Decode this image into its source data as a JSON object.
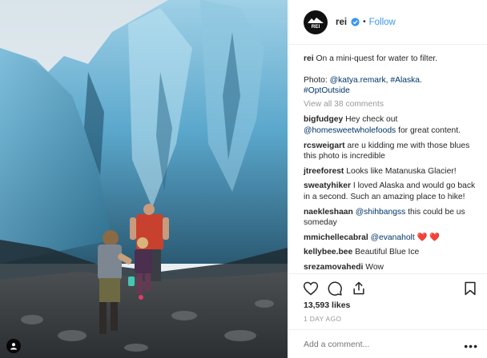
{
  "post": {
    "author": "rei",
    "follow_label": "Follow",
    "dot": "•",
    "caption": {
      "user": "rei",
      "text": "On a mini-quest for water to filter.",
      "photo_prefix": "Photo: ",
      "photo_credit": "@katya.remark",
      "sep": ", ",
      "tag1": "#Alaska",
      "tag1_tail": ".",
      "tag2": "#OptOutside"
    },
    "view_all": "View all 38 comments",
    "comments": [
      {
        "user": "bigfudgey",
        "pre": "Hey check out",
        "mention": "@homesweetwholefoods",
        "post": "for great content."
      },
      {
        "user": "rcsweigart",
        "text": "are u kidding me with those blues this photo is incredible"
      },
      {
        "user": "jtreeforest",
        "text": "Looks like Matanuska Glacier!"
      },
      {
        "user": "sweatyhiker",
        "text": "I loved Alaska and would go back in a second. Such an amazing place to hike!"
      },
      {
        "user": "naekleshaan",
        "mention": "@shihbangss",
        "post": "this could be us someday"
      },
      {
        "user": "mmichellecabral",
        "mention": "@evanaholt",
        "emoji": "❤️ ❤️"
      },
      {
        "user": "kellybee.bee",
        "text": "Beautiful Blue Ice"
      },
      {
        "user": "srezamovahedi",
        "text": "Wow"
      }
    ],
    "likes": "13,593 likes",
    "date": "1 DAY AGO",
    "add_comment_placeholder": "Add a comment...",
    "more_label": "•••"
  },
  "icons": {
    "avatar": "rei-logo-icon",
    "verified": "verified-badge-icon",
    "like": "heart-icon",
    "comment": "comment-bubble-icon",
    "share": "share-icon",
    "save": "bookmark-icon",
    "tag": "person-tag-icon"
  },
  "colors": {
    "link": "#003569",
    "follow": "#3897f0",
    "muted": "#999999",
    "verified": "#3897f0"
  }
}
